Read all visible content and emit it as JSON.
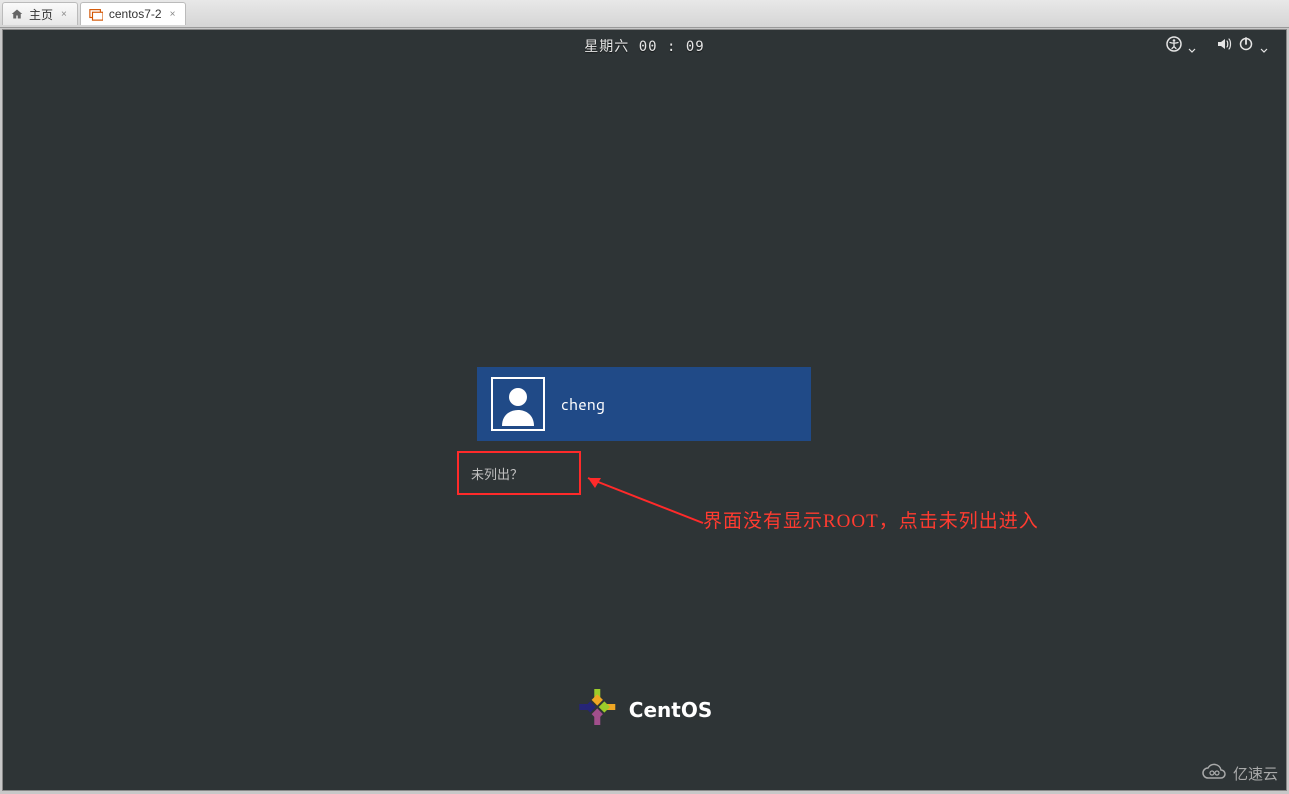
{
  "tabs": [
    {
      "label": "主页"
    },
    {
      "label": "centos7-2"
    }
  ],
  "topbar": {
    "clock": "星期六 00 : 09"
  },
  "login": {
    "username": "cheng",
    "not_listed": "未列出？"
  },
  "annotation": {
    "text": "界面没有显示ROOT，点击未列出进入"
  },
  "branding": {
    "os_name": "CentOS"
  },
  "watermark": {
    "text": "亿速云"
  }
}
